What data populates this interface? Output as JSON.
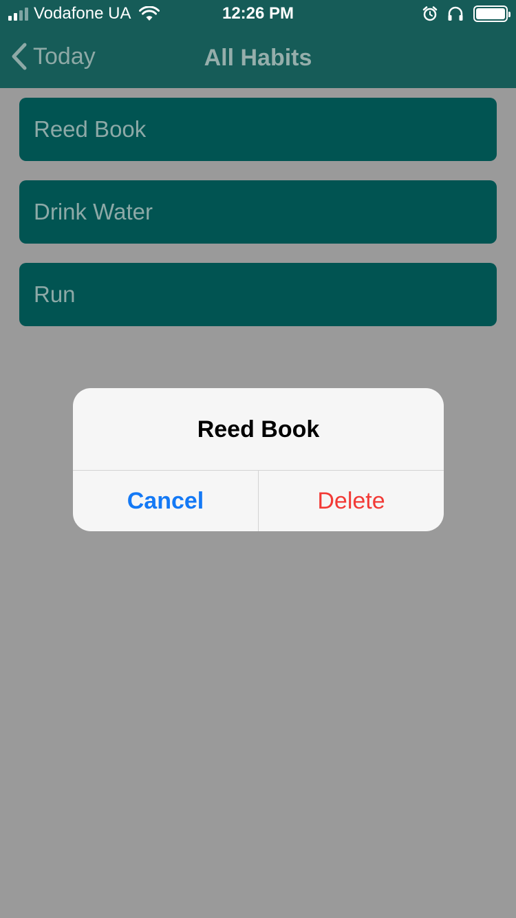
{
  "status_bar": {
    "carrier": "Vodafone UA",
    "time": "12:26 PM",
    "signal_bars": 4,
    "signal_bars_active": 2,
    "battery_level": 1.0
  },
  "nav": {
    "back_label": "Today",
    "title": "All Habits"
  },
  "habits": [
    {
      "label": "Reed Book"
    },
    {
      "label": "Drink Water"
    },
    {
      "label": "Run"
    }
  ],
  "alert": {
    "title": "Reed Book",
    "cancel_label": "Cancel",
    "delete_label": "Delete"
  },
  "colors": {
    "nav_background": "#165c58",
    "habit_background": "#015452",
    "cancel_color": "#1479f5",
    "delete_color": "#f23a36"
  }
}
